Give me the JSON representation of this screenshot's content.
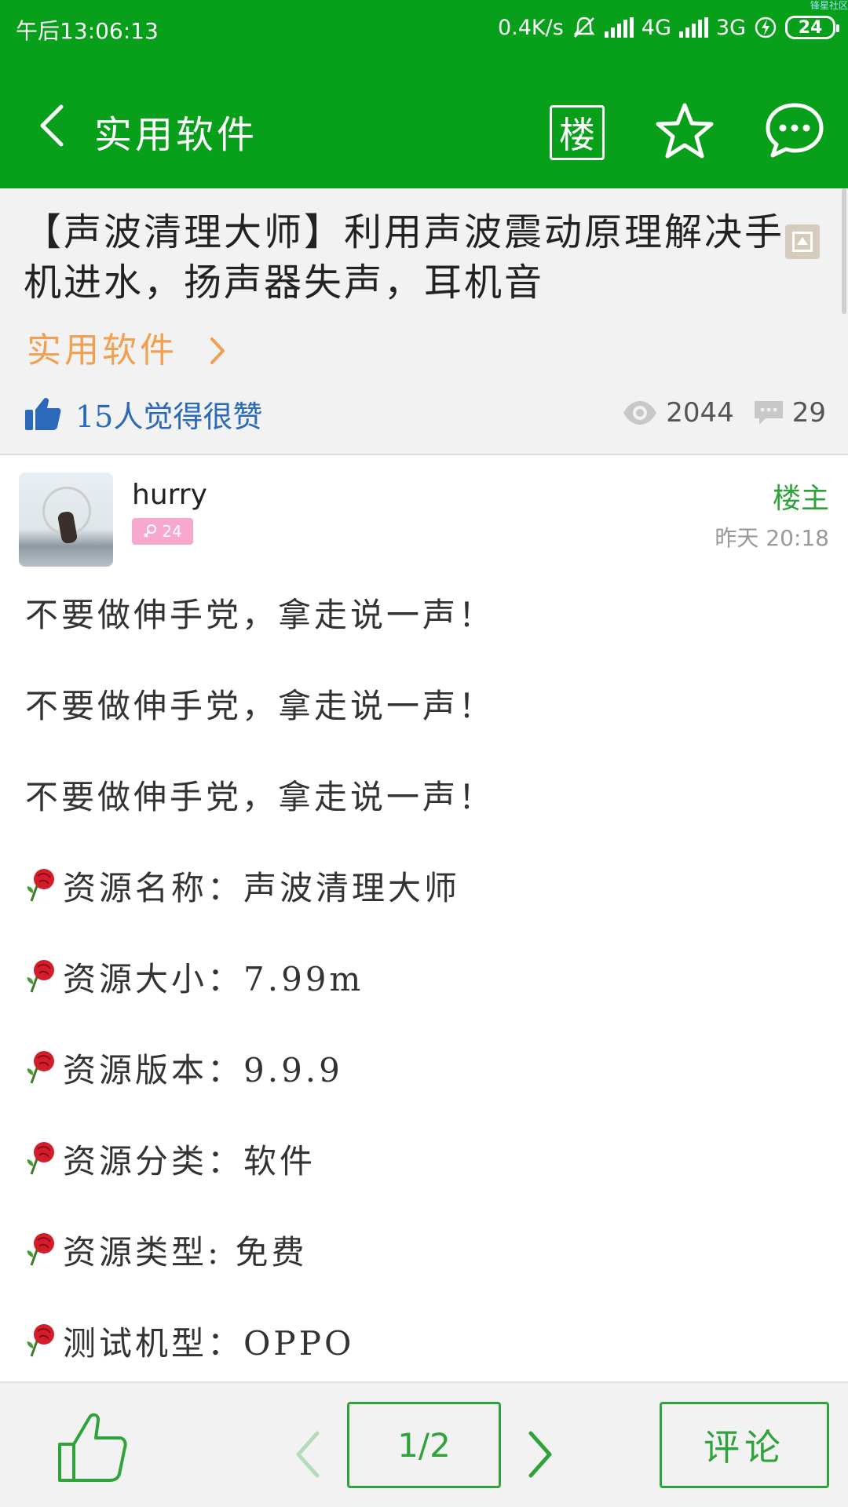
{
  "status_bar": {
    "time": "午后13:06:13",
    "speed": "0.4K/s",
    "network1": "4G",
    "network2": "3G",
    "battery": "24",
    "corner_text": "锋星社区",
    "icons": [
      "mute-icon",
      "signal-icon",
      "charging-icon",
      "battery-icon"
    ]
  },
  "app_bar": {
    "title": "实用软件",
    "floor_label": "楼",
    "icons": [
      "back-icon",
      "star-icon",
      "chat-icon"
    ],
    "background": "#08a01a"
  },
  "post": {
    "title": "【声波清理大师】利用声波震动原理解决手机进水，扬声器失声，耳机音",
    "category": "实用软件",
    "likes_text": "15人觉得很赞",
    "views": "2044",
    "comments": "29"
  },
  "author": {
    "name": "hurry",
    "level": "24",
    "role": "楼主",
    "time": "昨天 20:18"
  },
  "body": {
    "lines": [
      {
        "rose": false,
        "text": "不要做伸手党，拿走说一声！"
      },
      {
        "rose": false,
        "text": "不要做伸手党，拿走说一声！"
      },
      {
        "rose": false,
        "text": "不要做伸手党，拿走说一声！"
      },
      {
        "rose": true,
        "text": "资源名称：声波清理大师"
      },
      {
        "rose": true,
        "text": "资源大小：7.99m"
      },
      {
        "rose": true,
        "text": "资源版本：9.9.9"
      },
      {
        "rose": true,
        "text": "资源分类：软件"
      },
      {
        "rose": true,
        "text": "资源类型: 免费"
      },
      {
        "rose": true,
        "text": "测试机型：OPPO"
      }
    ]
  },
  "bottom_bar": {
    "page": "1/2",
    "comment_label": "评论",
    "accent": "#2fa33a"
  }
}
